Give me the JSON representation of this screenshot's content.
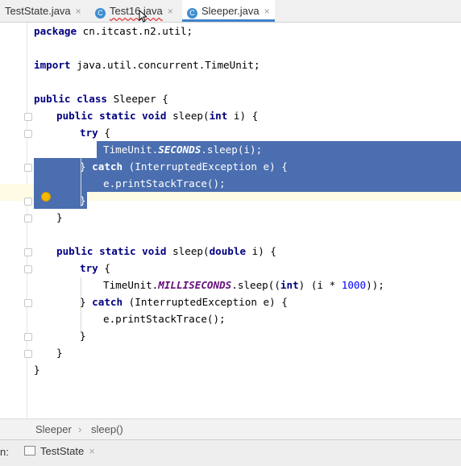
{
  "tabs": [
    {
      "label": "TestState.java",
      "close": "×"
    },
    {
      "label": "Test16.java",
      "icon": "C",
      "close": "×"
    },
    {
      "label": "Sleeper.java",
      "icon": "C",
      "close": "×"
    }
  ],
  "code": {
    "lines": [
      [
        "package",
        " cn.itcast.n2.util;"
      ],
      [
        "import",
        " java.util.concurrent.TimeUnit;"
      ],
      [
        "public class",
        " Sleeper {"
      ],
      [
        "public static void",
        " sleep(",
        "int",
        " i) {"
      ],
      [
        "try",
        " {"
      ],
      [
        "TimeUnit.",
        "SECONDS",
        ".sleep(i);"
      ],
      [
        "} ",
        "catch",
        " (InterruptedException e) {"
      ],
      [
        "e.printStackTrace();"
      ],
      [
        "}"
      ],
      [
        "}"
      ],
      [
        "public static void",
        " sleep(",
        "double",
        " i) {"
      ],
      [
        "try",
        " {"
      ],
      [
        "TimeUnit.",
        "MILLISECONDS",
        ".sleep((",
        "int",
        ") (i * ",
        "1000",
        "));"
      ],
      [
        "} ",
        "catch",
        " (InterruptedException e) {"
      ],
      [
        "e.printStackTrace();"
      ],
      [
        "}"
      ],
      [
        "}"
      ],
      [
        "}"
      ]
    ]
  },
  "breadcrumb": {
    "class": "Sleeper",
    "sep": "›",
    "method": "sleep()"
  },
  "run": {
    "label": "n:",
    "tab": "TestState",
    "close": "×"
  },
  "colors": {
    "selection": "#4a6eaf",
    "keyword": "#000080",
    "static_field": "#660e7a",
    "number": "#0000ff"
  }
}
